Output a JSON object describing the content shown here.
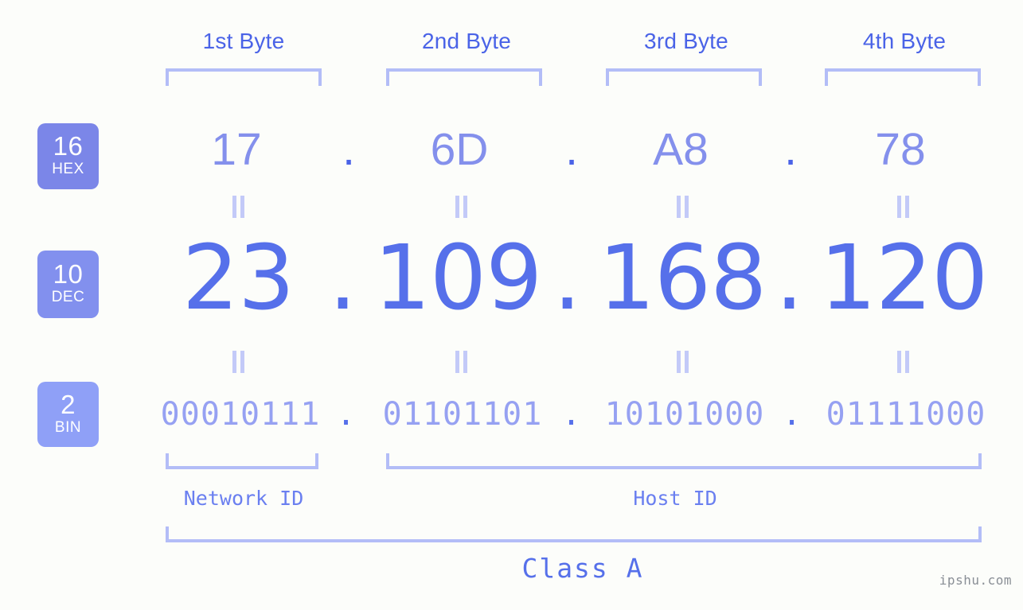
{
  "background_color": "#fcfdfa",
  "accent_colors": {
    "bracket": "#b3bdf7",
    "hex_text": "#8490ec",
    "dec_text": "#5670ea",
    "bin_text": "#96a1f2",
    "header_text": "#4a63e7",
    "badge_hex": "#7b86e8",
    "badge_dec": "#8290ee",
    "badge_bin": "#8fa0f7",
    "equals_mark": "#c3caf8",
    "watermark": "#8a8f96"
  },
  "byte_headers": [
    "1st Byte",
    "2nd Byte",
    "3rd Byte",
    "4th Byte"
  ],
  "rows": [
    {
      "base_number": "16",
      "base_name": "HEX",
      "values": [
        "17",
        "6D",
        "A8",
        "78"
      ],
      "separator": "."
    },
    {
      "base_number": "10",
      "base_name": "DEC",
      "values": [
        "23",
        "109",
        "168",
        "120"
      ],
      "separator": "."
    },
    {
      "base_number": "2",
      "base_name": "BIN",
      "values": [
        "00010111",
        "01101101",
        "10101000",
        "01111000"
      ],
      "separator": "."
    }
  ],
  "partitions": {
    "network_id_label": "Network ID",
    "host_id_label": "Host ID"
  },
  "class_label": "Class A",
  "watermark": "ipshu.com"
}
